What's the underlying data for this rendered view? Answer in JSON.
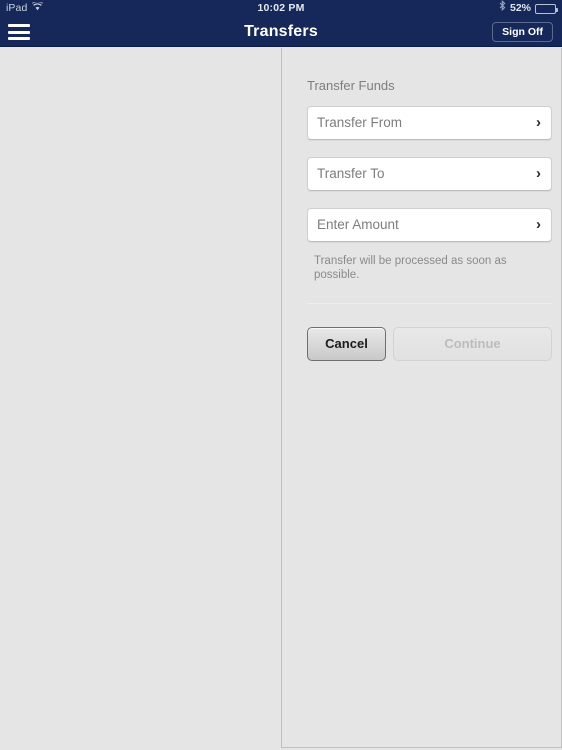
{
  "statusbar": {
    "device_label": "iPad",
    "wifi_icon": "wifi-icon",
    "time": "10:02 PM",
    "bluetooth_icon": "bluetooth-icon",
    "battery_percent": "52%",
    "battery_icon": "battery-icon"
  },
  "navbar": {
    "menu_icon": "hamburger-menu-icon",
    "title": "Transfers",
    "signoff_label": "Sign Off"
  },
  "panel": {
    "section_title": "Transfer Funds",
    "fields": [
      {
        "label": "Transfer From",
        "chevron": "›",
        "value": ""
      },
      {
        "label": "Transfer To",
        "chevron": "›",
        "value": ""
      },
      {
        "label": "Enter Amount",
        "chevron": "›",
        "value": ""
      }
    ],
    "helper_text": "Transfer will be processed as soon as possible.",
    "cancel_label": "Cancel",
    "continue_label": "Continue"
  },
  "colors": {
    "navbar_navy": "#16285a",
    "page_background": "#e5e5e5",
    "field_white": "#ffffff",
    "muted_text": "#7d7d7d",
    "disabled_text": "#bcbcbc"
  }
}
